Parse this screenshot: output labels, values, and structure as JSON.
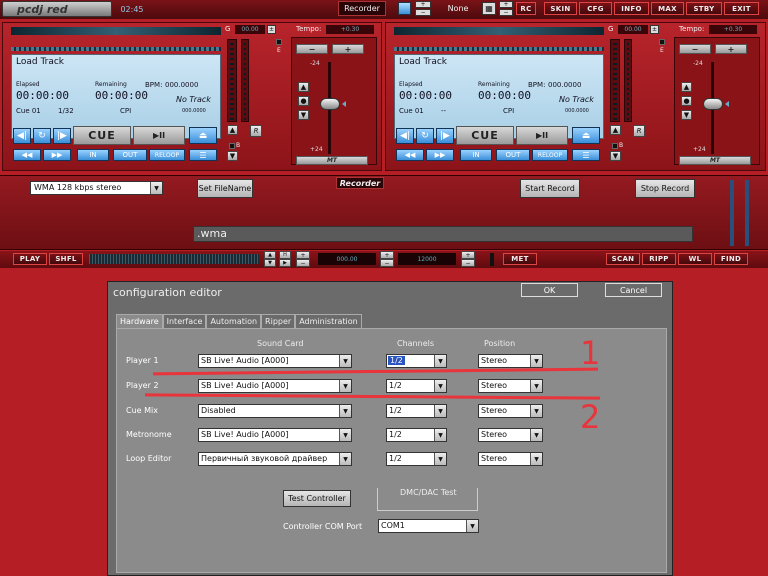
{
  "topbar": {
    "logo": "pcdj red",
    "clock": "02:45",
    "recorder_label": "Recorder",
    "none_label": "None",
    "rc_label": "RC",
    "buttons": [
      "SKIN",
      "CFG",
      "INFO",
      "MAX",
      "STBY",
      "EXIT"
    ]
  },
  "decks": [
    {
      "gain_label": "G",
      "gain_value": "00.00",
      "tempo_label": "Tempo:",
      "tempo_value": "+0.30",
      "load_label": "Load Track",
      "elapsed_label": "Elapsed",
      "elapsed_time": "00:00:00",
      "remaining_label": "Remaining",
      "remaining_time": "00:00:00",
      "bpm_label": "BPM:",
      "bpm_value": "000.0000",
      "track_state": "No Track",
      "cue_label": "Cue 01",
      "cue_count": "1/32",
      "cpi_label": "CPI",
      "cpi_value": "000.0000",
      "cue_btn": "CUE",
      "play_btn": "▶II",
      "eject_btn": "⏏",
      "in_btn": "IN",
      "out_btn": "OUT",
      "reloop_btn": "RELOOP",
      "mt_label": "MT",
      "scale_top": "-24",
      "scale_bottom": "+24",
      "e_label": "E",
      "b_label": "B",
      "r_label": "R"
    },
    {
      "gain_label": "G",
      "gain_value": "00.00",
      "tempo_label": "Tempo:",
      "tempo_value": "+0.30",
      "load_label": "Load Track",
      "elapsed_label": "Elapsed",
      "elapsed_time": "00:00:00",
      "remaining_label": "Remaining",
      "remaining_time": "00:00:00",
      "bpm_label": "BPM:",
      "bpm_value": "000.0000",
      "track_state": "No Track",
      "cue_label": "Cue 01",
      "cue_count": "--",
      "cpi_label": "CPI",
      "cpi_value": "000.0000",
      "cue_btn": "CUE",
      "play_btn": "▶II",
      "eject_btn": "⏏",
      "in_btn": "IN",
      "out_btn": "OUT",
      "reloop_btn": "RELOOP",
      "mt_label": "MT",
      "scale_top": "-24",
      "scale_bottom": "+24",
      "e_label": "E",
      "b_label": "B",
      "r_label": "R"
    }
  ],
  "recorder": {
    "format_value": "WMA 128 kbps stereo",
    "set_filename": "Set FileName",
    "title": "Recorder",
    "start": "Start Record",
    "stop": "Stop Record",
    "filename": ".wma"
  },
  "bottombar": {
    "play": "PLAY",
    "shfl": "SHFL",
    "display1": "000.00",
    "display2": "12000",
    "met": "MET",
    "scan": "SCAN",
    "ripp": "RIPP",
    "wl": "WL",
    "find": "FIND"
  },
  "config": {
    "title": "configuration editor",
    "ok": "OK",
    "cancel": "Cancel",
    "tabs": [
      "Hardware",
      "Interface",
      "Automation",
      "Ripper",
      "Administration"
    ],
    "headers": {
      "sound_card": "Sound Card",
      "channels": "Channels",
      "position": "Position"
    },
    "rows": [
      {
        "label": "Player 1",
        "card": "SB Live! Audio [A000]",
        "channels": "1/2",
        "position": "Stereo"
      },
      {
        "label": "Player 2",
        "card": "SB Live! Audio [A000]",
        "channels": "1/2",
        "position": "Stereo"
      },
      {
        "label": "Cue Mix",
        "card": "Disabled",
        "channels": "1/2",
        "position": "Stereo"
      },
      {
        "label": "Metronome",
        "card": "SB Live! Audio [A000]",
        "channels": "1/2",
        "position": "Stereo"
      },
      {
        "label": "Loop Editor",
        "card": "Первичный звуковой драйвер",
        "channels": "1/2",
        "position": "Stereo"
      }
    ],
    "test_controller": "Test Controller",
    "dmc_label": "DMC/DAC Test",
    "com_label": "Controller COM Port",
    "com_value": "COM1",
    "annotation_1": "1",
    "annotation_2": "2"
  },
  "colors": {
    "accent": "#b51e24",
    "annotation": "#e8343a",
    "lcd": "#bcdcf0"
  }
}
